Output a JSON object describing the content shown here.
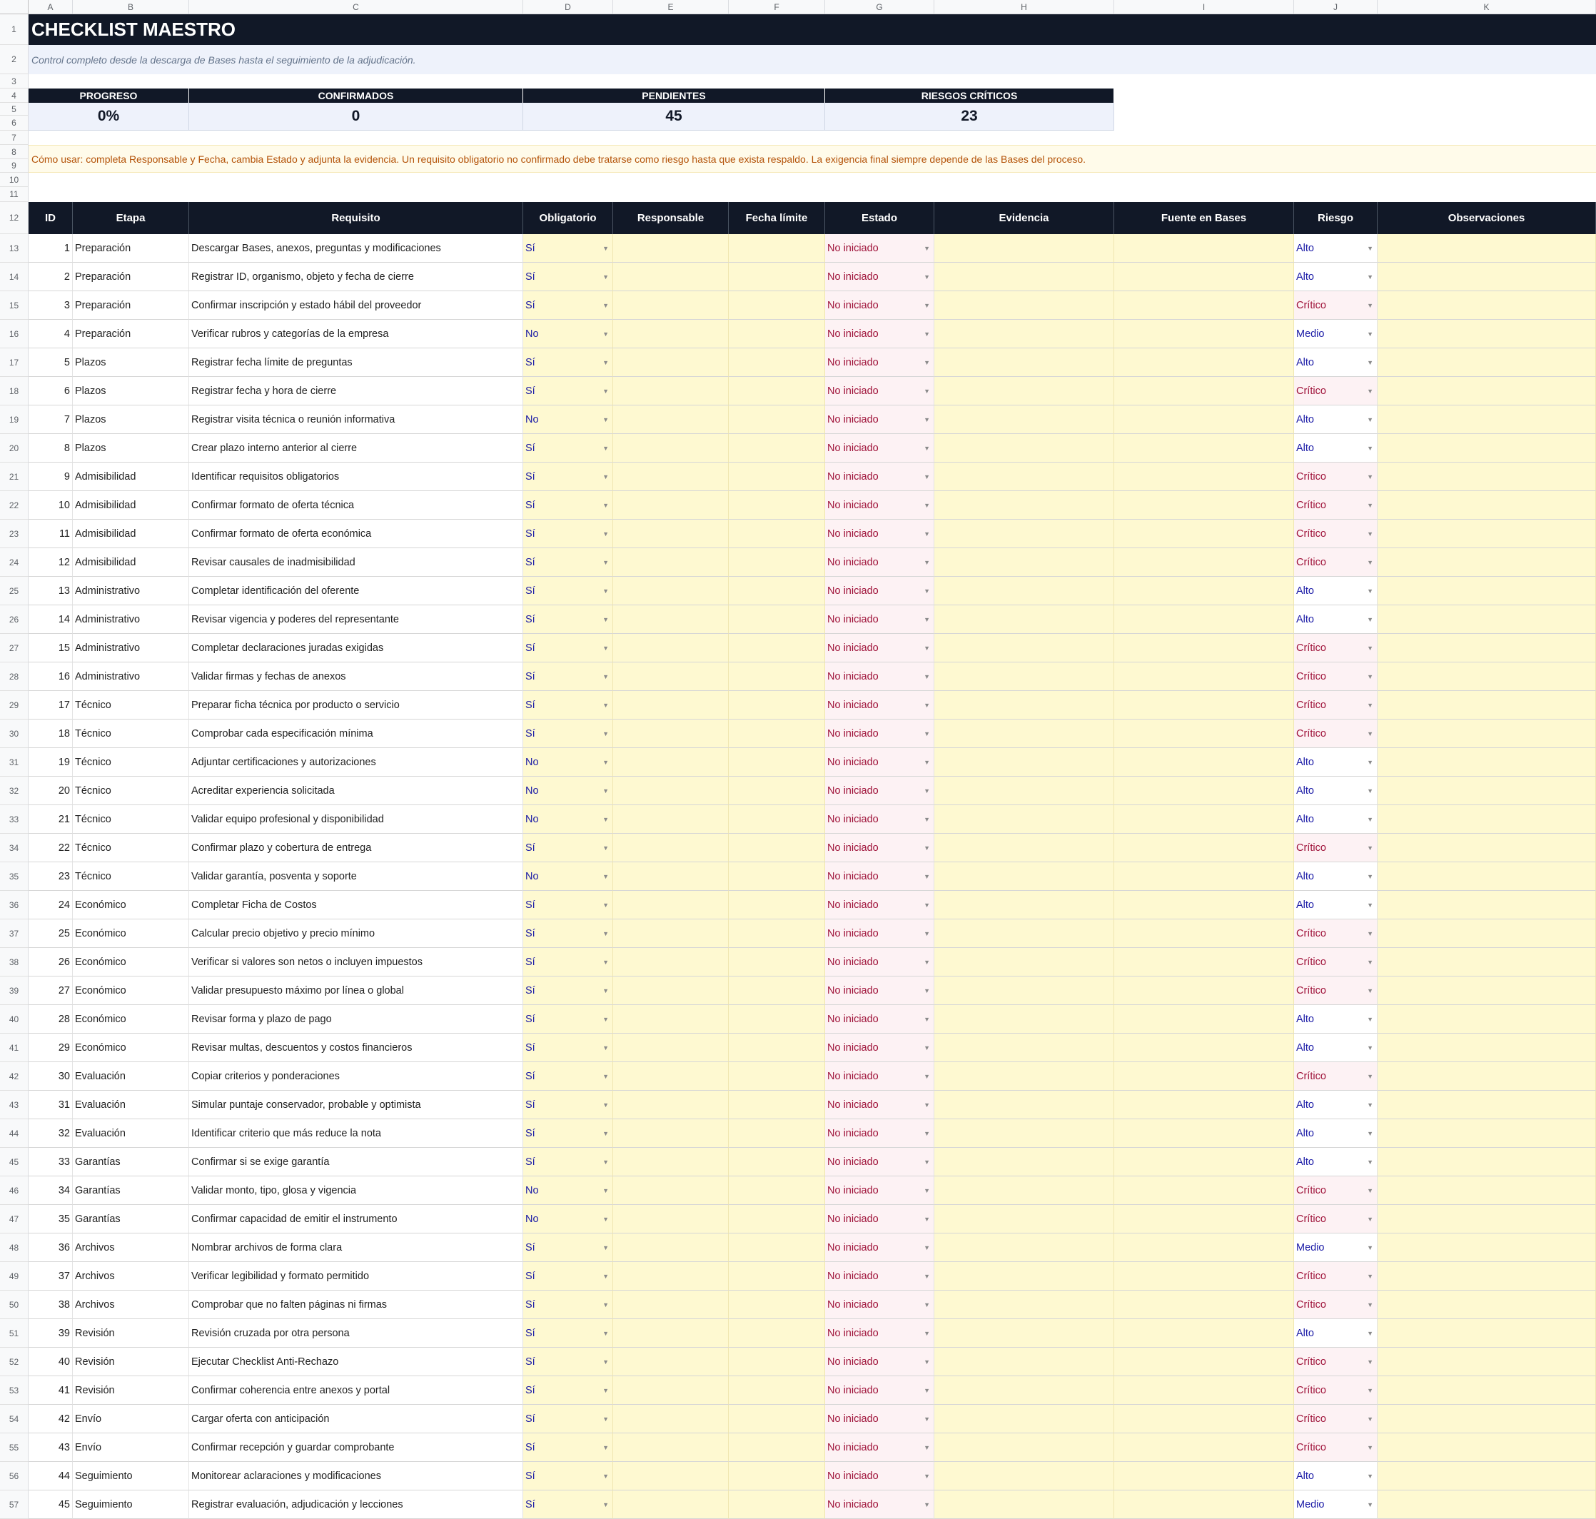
{
  "columns": [
    "A",
    "B",
    "C",
    "D",
    "E",
    "F",
    "G",
    "H",
    "I",
    "J",
    "K"
  ],
  "title": "CHECKLIST MAESTRO",
  "subtitle": "Control completo desde la descarga de Bases hasta el seguimiento de la adjudicación.",
  "kpis": [
    {
      "label": "PROGRESO",
      "value": "0%"
    },
    {
      "label": "CONFIRMADOS",
      "value": "0"
    },
    {
      "label": "PENDIENTES",
      "value": "45"
    },
    {
      "label": "RIESGOS CRÍTICOS",
      "value": "23"
    }
  ],
  "instructions": "Cómo usar: completa Responsable y Fecha, cambia Estado y adjunta la evidencia. Un requisito obligatorio no confirmado debe tratarse como riesgo hasta que exista respaldo. La exigencia final siempre depende de las Bases del proceso.",
  "table_headers": [
    "ID",
    "Etapa",
    "Requisito",
    "Obligatorio",
    "Responsable",
    "Fecha límite",
    "Estado",
    "Evidencia",
    "Fuente en Bases",
    "Riesgo",
    "Observaciones"
  ],
  "rows": [
    {
      "id": "1",
      "etapa": "Preparación",
      "req": "Descargar Bases, anexos, preguntas y modificaciones",
      "obl": "Sí",
      "estado": "No iniciado",
      "riesgo": "Alto"
    },
    {
      "id": "2",
      "etapa": "Preparación",
      "req": "Registrar ID, organismo, objeto y fecha de cierre",
      "obl": "Sí",
      "estado": "No iniciado",
      "riesgo": "Alto"
    },
    {
      "id": "3",
      "etapa": "Preparación",
      "req": "Confirmar inscripción y estado hábil del proveedor",
      "obl": "Sí",
      "estado": "No iniciado",
      "riesgo": "Crítico"
    },
    {
      "id": "4",
      "etapa": "Preparación",
      "req": "Verificar rubros y categorías de la empresa",
      "obl": "No",
      "estado": "No iniciado",
      "riesgo": "Medio"
    },
    {
      "id": "5",
      "etapa": "Plazos",
      "req": "Registrar fecha límite de preguntas",
      "obl": "Sí",
      "estado": "No iniciado",
      "riesgo": "Alto"
    },
    {
      "id": "6",
      "etapa": "Plazos",
      "req": "Registrar fecha y hora de cierre",
      "obl": "Sí",
      "estado": "No iniciado",
      "riesgo": "Crítico"
    },
    {
      "id": "7",
      "etapa": "Plazos",
      "req": "Registrar visita técnica o reunión informativa",
      "obl": "No",
      "estado": "No iniciado",
      "riesgo": "Alto"
    },
    {
      "id": "8",
      "etapa": "Plazos",
      "req": "Crear plazo interno anterior al cierre",
      "obl": "Sí",
      "estado": "No iniciado",
      "riesgo": "Alto"
    },
    {
      "id": "9",
      "etapa": "Admisibilidad",
      "req": "Identificar requisitos obligatorios",
      "obl": "Sí",
      "estado": "No iniciado",
      "riesgo": "Crítico"
    },
    {
      "id": "10",
      "etapa": "Admisibilidad",
      "req": "Confirmar formato de oferta técnica",
      "obl": "Sí",
      "estado": "No iniciado",
      "riesgo": "Crítico"
    },
    {
      "id": "11",
      "etapa": "Admisibilidad",
      "req": "Confirmar formato de oferta económica",
      "obl": "Sí",
      "estado": "No iniciado",
      "riesgo": "Crítico"
    },
    {
      "id": "12",
      "etapa": "Admisibilidad",
      "req": "Revisar causales de inadmisibilidad",
      "obl": "Sí",
      "estado": "No iniciado",
      "riesgo": "Crítico"
    },
    {
      "id": "13",
      "etapa": "Administrativo",
      "req": "Completar identificación del oferente",
      "obl": "Sí",
      "estado": "No iniciado",
      "riesgo": "Alto"
    },
    {
      "id": "14",
      "etapa": "Administrativo",
      "req": "Revisar vigencia y poderes del representante",
      "obl": "Sí",
      "estado": "No iniciado",
      "riesgo": "Alto"
    },
    {
      "id": "15",
      "etapa": "Administrativo",
      "req": "Completar declaraciones juradas exigidas",
      "obl": "Sí",
      "estado": "No iniciado",
      "riesgo": "Crítico"
    },
    {
      "id": "16",
      "etapa": "Administrativo",
      "req": "Validar firmas y fechas de anexos",
      "obl": "Sí",
      "estado": "No iniciado",
      "riesgo": "Crítico"
    },
    {
      "id": "17",
      "etapa": "Técnico",
      "req": "Preparar ficha técnica por producto o servicio",
      "obl": "Sí",
      "estado": "No iniciado",
      "riesgo": "Crítico"
    },
    {
      "id": "18",
      "etapa": "Técnico",
      "req": "Comprobar cada especificación mínima",
      "obl": "Sí",
      "estado": "No iniciado",
      "riesgo": "Crítico"
    },
    {
      "id": "19",
      "etapa": "Técnico",
      "req": "Adjuntar certificaciones y autorizaciones",
      "obl": "No",
      "estado": "No iniciado",
      "riesgo": "Alto"
    },
    {
      "id": "20",
      "etapa": "Técnico",
      "req": "Acreditar experiencia solicitada",
      "obl": "No",
      "estado": "No iniciado",
      "riesgo": "Alto"
    },
    {
      "id": "21",
      "etapa": "Técnico",
      "req": "Validar equipo profesional y disponibilidad",
      "obl": "No",
      "estado": "No iniciado",
      "riesgo": "Alto"
    },
    {
      "id": "22",
      "etapa": "Técnico",
      "req": "Confirmar plazo y cobertura de entrega",
      "obl": "Sí",
      "estado": "No iniciado",
      "riesgo": "Crítico"
    },
    {
      "id": "23",
      "etapa": "Técnico",
      "req": "Validar garantía, posventa y soporte",
      "obl": "No",
      "estado": "No iniciado",
      "riesgo": "Alto"
    },
    {
      "id": "24",
      "etapa": "Económico",
      "req": "Completar Ficha de Costos",
      "obl": "Sí",
      "estado": "No iniciado",
      "riesgo": "Alto"
    },
    {
      "id": "25",
      "etapa": "Económico",
      "req": "Calcular precio objetivo y precio mínimo",
      "obl": "Sí",
      "estado": "No iniciado",
      "riesgo": "Crítico"
    },
    {
      "id": "26",
      "etapa": "Económico",
      "req": "Verificar si valores son netos o incluyen impuestos",
      "obl": "Sí",
      "estado": "No iniciado",
      "riesgo": "Crítico"
    },
    {
      "id": "27",
      "etapa": "Económico",
      "req": "Validar presupuesto máximo por línea o global",
      "obl": "Sí",
      "estado": "No iniciado",
      "riesgo": "Crítico"
    },
    {
      "id": "28",
      "etapa": "Económico",
      "req": "Revisar forma y plazo de pago",
      "obl": "Sí",
      "estado": "No iniciado",
      "riesgo": "Alto"
    },
    {
      "id": "29",
      "etapa": "Económico",
      "req": "Revisar multas, descuentos y costos financieros",
      "obl": "Sí",
      "estado": "No iniciado",
      "riesgo": "Alto"
    },
    {
      "id": "30",
      "etapa": "Evaluación",
      "req": "Copiar criterios y ponderaciones",
      "obl": "Sí",
      "estado": "No iniciado",
      "riesgo": "Crítico"
    },
    {
      "id": "31",
      "etapa": "Evaluación",
      "req": "Simular puntaje conservador, probable y optimista",
      "obl": "Sí",
      "estado": "No iniciado",
      "riesgo": "Alto"
    },
    {
      "id": "32",
      "etapa": "Evaluación",
      "req": "Identificar criterio que más reduce la nota",
      "obl": "Sí",
      "estado": "No iniciado",
      "riesgo": "Alto"
    },
    {
      "id": "33",
      "etapa": "Garantías",
      "req": "Confirmar si se exige garantía",
      "obl": "Sí",
      "estado": "No iniciado",
      "riesgo": "Alto"
    },
    {
      "id": "34",
      "etapa": "Garantías",
      "req": "Validar monto, tipo, glosa y vigencia",
      "obl": "No",
      "estado": "No iniciado",
      "riesgo": "Crítico"
    },
    {
      "id": "35",
      "etapa": "Garantías",
      "req": "Confirmar capacidad de emitir el instrumento",
      "obl": "No",
      "estado": "No iniciado",
      "riesgo": "Crítico"
    },
    {
      "id": "36",
      "etapa": "Archivos",
      "req": "Nombrar archivos de forma clara",
      "obl": "Sí",
      "estado": "No iniciado",
      "riesgo": "Medio"
    },
    {
      "id": "37",
      "etapa": "Archivos",
      "req": "Verificar legibilidad y formato permitido",
      "obl": "Sí",
      "estado": "No iniciado",
      "riesgo": "Crítico"
    },
    {
      "id": "38",
      "etapa": "Archivos",
      "req": "Comprobar que no falten páginas ni firmas",
      "obl": "Sí",
      "estado": "No iniciado",
      "riesgo": "Crítico"
    },
    {
      "id": "39",
      "etapa": "Revisión",
      "req": "Revisión cruzada por otra persona",
      "obl": "Sí",
      "estado": "No iniciado",
      "riesgo": "Alto"
    },
    {
      "id": "40",
      "etapa": "Revisión",
      "req": "Ejecutar Checklist Anti-Rechazo",
      "obl": "Sí",
      "estado": "No iniciado",
      "riesgo": "Crítico"
    },
    {
      "id": "41",
      "etapa": "Revisión",
      "req": "Confirmar coherencia entre anexos y portal",
      "obl": "Sí",
      "estado": "No iniciado",
      "riesgo": "Crítico"
    },
    {
      "id": "42",
      "etapa": "Envío",
      "req": "Cargar oferta con anticipación",
      "obl": "Sí",
      "estado": "No iniciado",
      "riesgo": "Crítico"
    },
    {
      "id": "43",
      "etapa": "Envío",
      "req": "Confirmar recepción y guardar comprobante",
      "obl": "Sí",
      "estado": "No iniciado",
      "riesgo": "Crítico"
    },
    {
      "id": "44",
      "etapa": "Seguimiento",
      "req": "Monitorear aclaraciones y modificaciones",
      "obl": "Sí",
      "estado": "No iniciado",
      "riesgo": "Alto"
    },
    {
      "id": "45",
      "etapa": "Seguimiento",
      "req": "Registrar evaluación, adjudicación y lecciones",
      "obl": "Sí",
      "estado": "No iniciado",
      "riesgo": "Medio"
    }
  ]
}
